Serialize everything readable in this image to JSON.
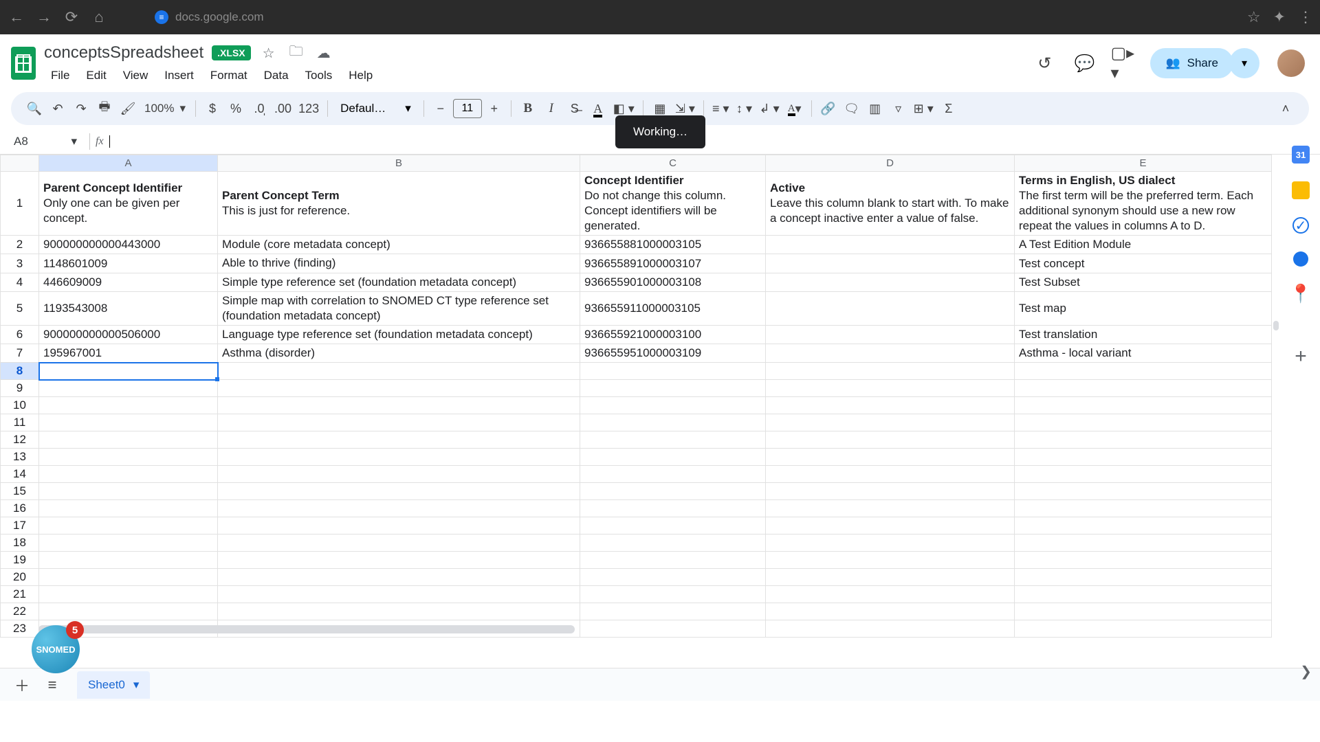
{
  "browser": {
    "url": "docs.google.com"
  },
  "doc": {
    "title": "conceptsSpreadsheet",
    "format_badge": ".XLSX"
  },
  "menus": [
    "File",
    "Edit",
    "View",
    "Insert",
    "Format",
    "Data",
    "Tools",
    "Help"
  ],
  "toolbar": {
    "zoom": "100%",
    "font": "Defaul…",
    "font_size": "11",
    "number_format_123": "123"
  },
  "share_label": "Share",
  "toast": "Working…",
  "name_box": "A8",
  "formula_value": "",
  "columns": [
    "A",
    "B",
    "C",
    "D",
    "E"
  ],
  "header_row": {
    "A": {
      "strong": "Parent Concept Identifier",
      "rest": "Only one can be given per concept."
    },
    "B": {
      "strong": "Parent Concept Term",
      "rest": "This is just for reference."
    },
    "C": {
      "strong": "Concept Identifier",
      "rest": "Do not change this column. Concept identifiers will be generated."
    },
    "D": {
      "strong": "Active",
      "rest": "Leave this column blank to start with. To make a concept inactive enter a value of false."
    },
    "E": {
      "strong": "Terms in English, US dialect",
      "rest": "The first term will be the preferred term. Each additional synonym should use a new row repeat the values in columns A to D."
    }
  },
  "rows": [
    {
      "n": "2",
      "A": "900000000000443000",
      "B": "Module (core metadata concept)",
      "C": "936655881000003105",
      "D": "",
      "E": "A Test Edition Module"
    },
    {
      "n": "3",
      "A": "1148601009",
      "B": "Able to thrive (finding)",
      "C": "936655891000003107",
      "D": "",
      "E": "Test concept"
    },
    {
      "n": "4",
      "A": "446609009",
      "B": "Simple type reference set (foundation metadata concept)",
      "C": "936655901000003108",
      "D": "",
      "E": "Test Subset"
    },
    {
      "n": "5",
      "A": "1193543008",
      "B": "Simple map with correlation to SNOMED CT type reference set (foundation metadata concept)",
      "C": "936655911000003105",
      "D": "",
      "E": "Test map"
    },
    {
      "n": "6",
      "A": "900000000000506000",
      "B": "Language type reference set (foundation metadata concept)",
      "C": "936655921000003100",
      "D": "",
      "E": "Test translation"
    },
    {
      "n": "7",
      "A": "195967001",
      "B": "Asthma (disorder)",
      "C": "936655951000003109",
      "D": "",
      "E": "Asthma - local variant"
    }
  ],
  "empty_rows": [
    "8",
    "9",
    "10",
    "11",
    "12",
    "13",
    "14",
    "15",
    "16",
    "17",
    "18",
    "19",
    "20",
    "21",
    "22",
    "23"
  ],
  "selected_row": "8",
  "sheet_tab": "Sheet0",
  "side_calendar_day": "31",
  "float_badge": {
    "text": "SNOMED",
    "count": "5"
  }
}
